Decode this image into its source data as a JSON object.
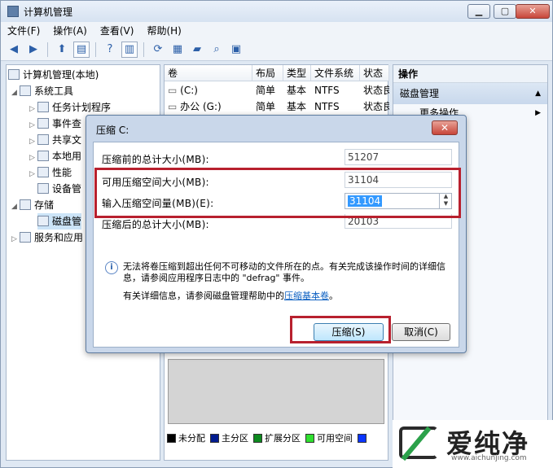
{
  "window": {
    "title": "计算机管理",
    "buttons": {
      "min": "▁",
      "max": "▢",
      "close": "✕"
    }
  },
  "menu": [
    "文件(F)",
    "操作(A)",
    "查看(V)",
    "帮助(H)"
  ],
  "tree": [
    {
      "label": "计算机管理(本地)",
      "level": 0,
      "icon": "computer-icon"
    },
    {
      "label": "系统工具",
      "level": 1,
      "icon": "tools-icon"
    },
    {
      "label": "任务计划程序",
      "level": 2,
      "icon": "clock-icon"
    },
    {
      "label": "事件查",
      "level": 2,
      "icon": "event-viewer-icon"
    },
    {
      "label": "共享文",
      "level": 2,
      "icon": "shared-folder-icon"
    },
    {
      "label": "本地用",
      "level": 2,
      "icon": "users-icon"
    },
    {
      "label": "性能",
      "level": 2,
      "icon": "performance-icon"
    },
    {
      "label": "设备管",
      "level": 2,
      "icon": "device-manager-icon"
    },
    {
      "label": "存储",
      "level": 1,
      "icon": "storage-icon"
    },
    {
      "label": "磁盘管",
      "level": 2,
      "icon": "disk-icon"
    },
    {
      "label": "服务和应用",
      "level": 1,
      "icon": "services-icon"
    }
  ],
  "volumes": {
    "columns": [
      "卷",
      "布局",
      "类型",
      "文件系统",
      "状态"
    ],
    "rows": [
      [
        "(C:)",
        "简单",
        "基本",
        "NTFS",
        "状态良"
      ],
      [
        "办公 (G:)",
        "简单",
        "基本",
        "NTFS",
        "状态良"
      ]
    ]
  },
  "actions": {
    "header": "操作",
    "section": "磁盘管理",
    "item": "更多操作"
  },
  "legend": [
    {
      "label": "未分配",
      "color": "#000000"
    },
    {
      "label": "主分区",
      "color": "#001b8f"
    },
    {
      "label": "扩展分区",
      "color": "#0d8a1f"
    },
    {
      "label": "可用空间",
      "color": "#2fe02f"
    },
    {
      "label": "",
      "color": "#0a35ff"
    }
  ],
  "dialog": {
    "title": "压缩 C:",
    "close": "✕",
    "fields": [
      {
        "label": "压缩前的总计大小(MB):",
        "value": "51207"
      },
      {
        "label": "可用压缩空间大小(MB):",
        "value": "31104"
      },
      {
        "label": "输入压缩空间量(MB)(E):",
        "value": "31104"
      },
      {
        "label": "压缩后的总计大小(MB):",
        "value": "20103"
      }
    ],
    "info_icon": "i",
    "info_text": "无法将卷压缩到超出任何不可移动的文件所在的点。有关完成该操作时间的详细信息，请参阅应用程序日志中的 \"defrag\" 事件。",
    "help_prefix": "有关详细信息，请参阅磁盘管理帮助中的",
    "help_link": "压缩基本卷",
    "help_suffix": "。",
    "ok": "压缩(S)",
    "cancel": "取消(C)"
  },
  "watermark": {
    "text": "爱纯净",
    "url": "www.aichunjing.com"
  }
}
